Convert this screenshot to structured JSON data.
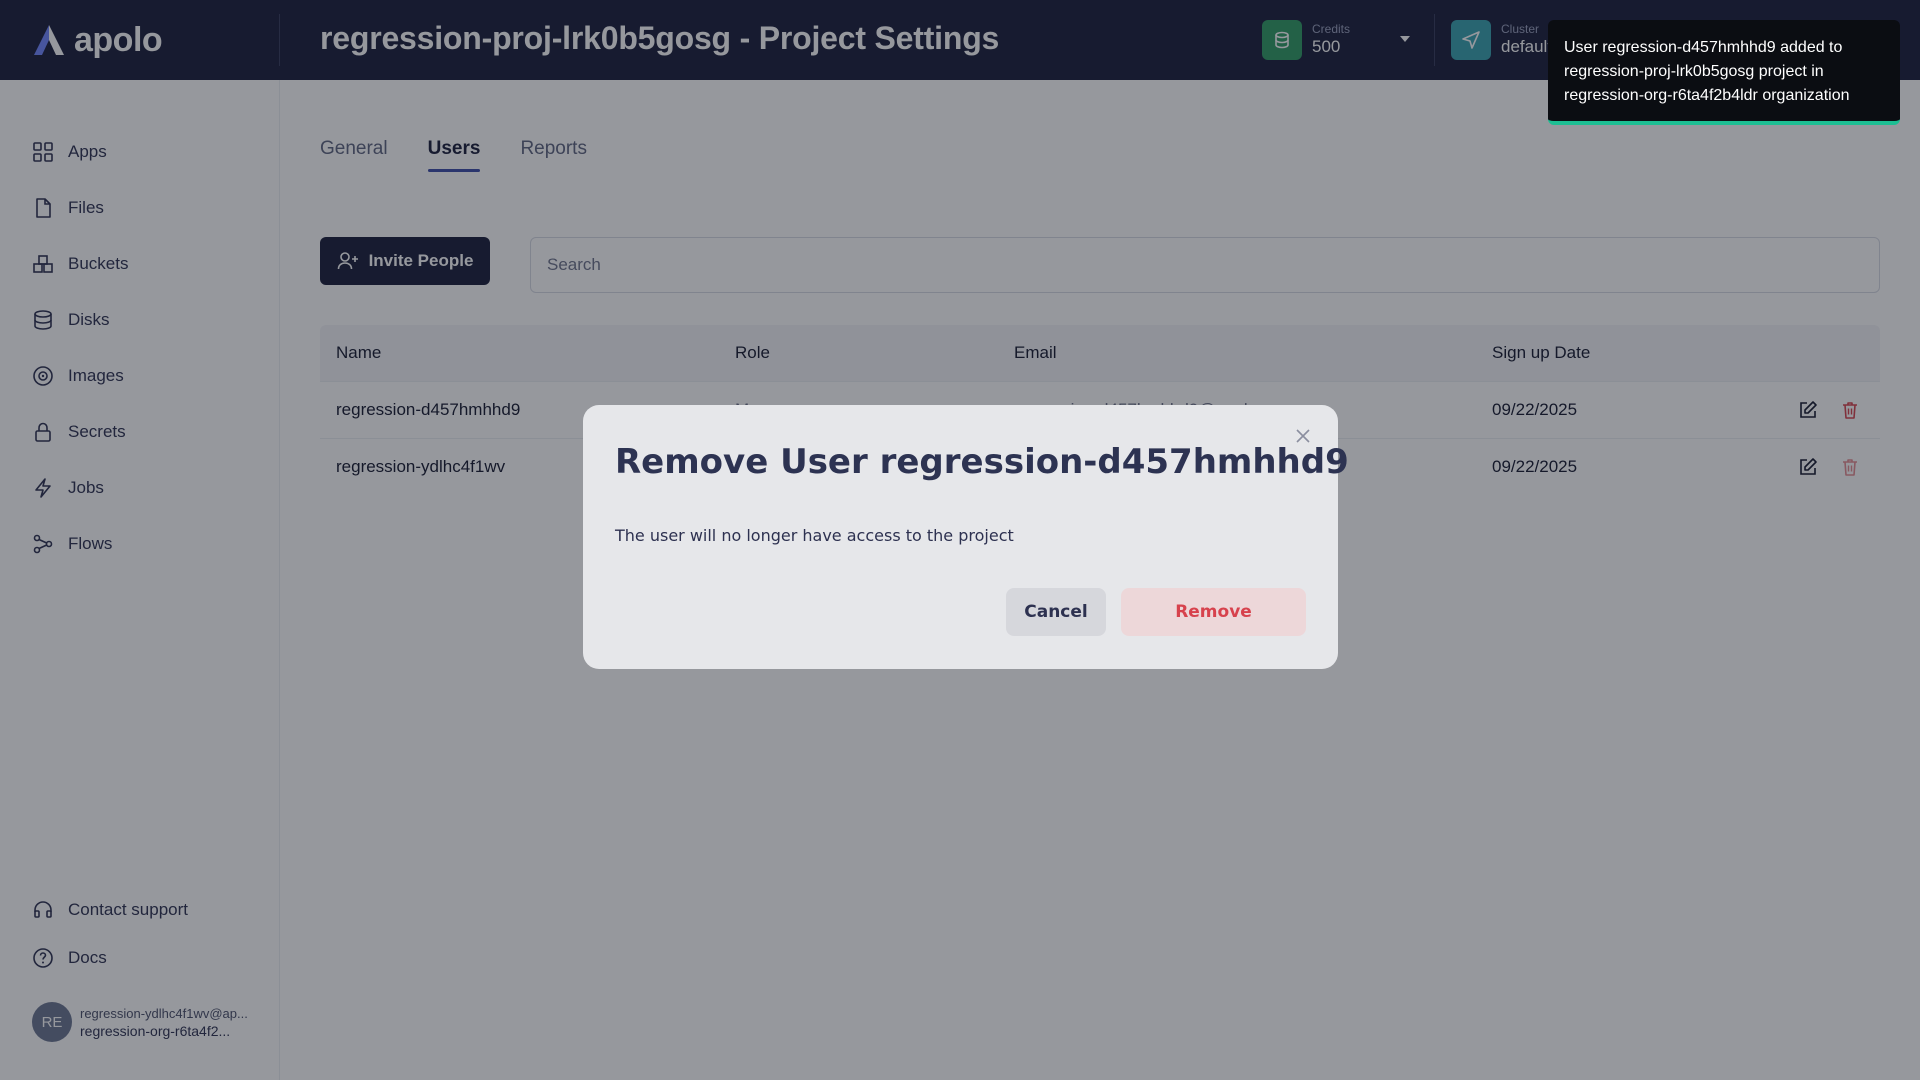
{
  "header": {
    "logo_text": "apolo",
    "title": "regression-proj-lrk0b5gosg - Project Settings",
    "credits_label": "Credits",
    "credits_value": "500",
    "cluster_label": "Cluster",
    "cluster_value": "default"
  },
  "sidebar": {
    "items": [
      {
        "label": "Apps",
        "icon": "apps-icon"
      },
      {
        "label": "Files",
        "icon": "file-icon"
      },
      {
        "label": "Buckets",
        "icon": "bucket-icon"
      },
      {
        "label": "Disks",
        "icon": "disk-icon"
      },
      {
        "label": "Images",
        "icon": "image-icon"
      },
      {
        "label": "Secrets",
        "icon": "lock-icon"
      },
      {
        "label": "Jobs",
        "icon": "lightning-icon"
      },
      {
        "label": "Flows",
        "icon": "flow-icon"
      }
    ],
    "bottom": [
      {
        "label": "Contact support",
        "icon": "headset-icon"
      },
      {
        "label": "Docs",
        "icon": "help-icon"
      }
    ],
    "user": {
      "initials": "RE",
      "email": "regression-ydlhc4f1wv@ap...",
      "org": "regression-org-r6ta4f2..."
    }
  },
  "tabs": [
    {
      "label": "General",
      "active": false
    },
    {
      "label": "Users",
      "active": true
    },
    {
      "label": "Reports",
      "active": false
    }
  ],
  "toolbar": {
    "invite_label": "Invite People",
    "search_placeholder": "Search"
  },
  "table": {
    "columns": [
      "Name",
      "Role",
      "Email",
      "Sign up Date"
    ],
    "rows": [
      {
        "name": "regression-d457hmhhd9",
        "role": "Manager",
        "email": "regression-d457hmhhd9@apolo.us",
        "date": "09/22/2025"
      },
      {
        "name": "regression-ydlhc4f1wv",
        "role": "",
        "email": "",
        "date": "09/22/2025"
      }
    ]
  },
  "modal": {
    "title": "Remove User regression-d457hmhhd9",
    "text": "The user will no longer have access to the project",
    "cancel_label": "Cancel",
    "remove_label": "Remove"
  },
  "toast": {
    "message": "User regression-d457hmhhd9 added to regression-proj-lrk0b5gosg project in regression-org-r6ta4f2b4ldr organization"
  },
  "colors": {
    "header_bg": "#181d3a",
    "accent": "#3b4ba8",
    "danger": "#d7424d",
    "credits_icon": "#2e9b63",
    "cluster_icon": "#37a3b0",
    "toast_border": "#1dbe93"
  }
}
